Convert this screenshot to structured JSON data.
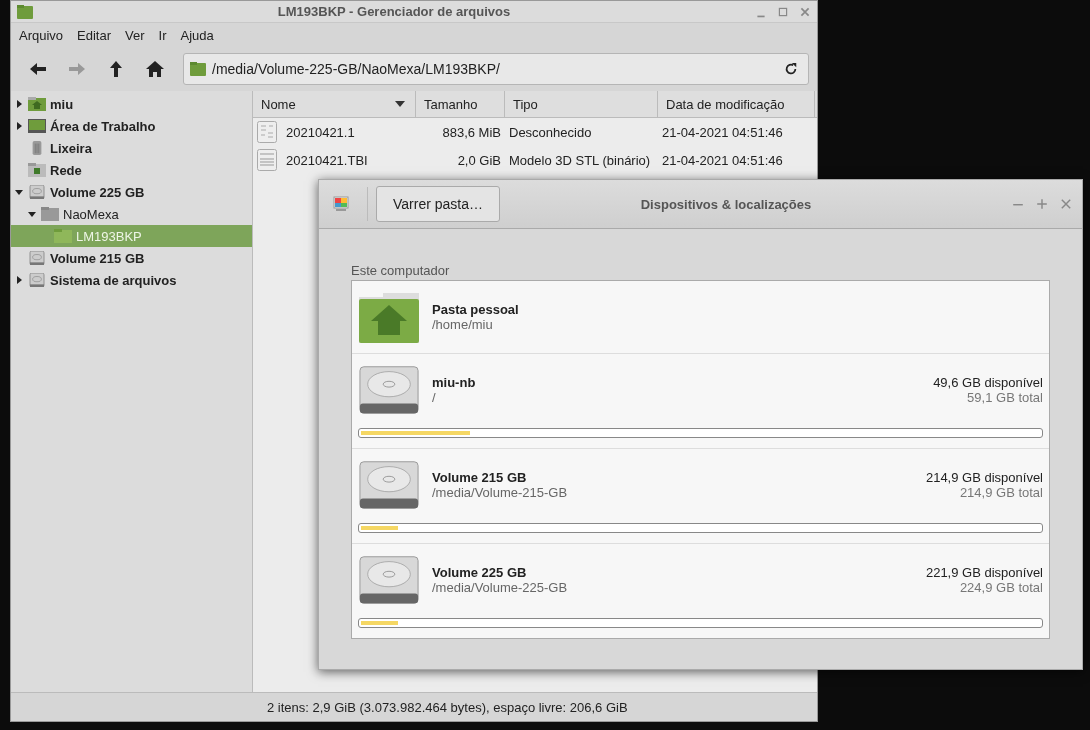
{
  "file_manager": {
    "window": {
      "title": "LM193BKP - Gerenciador de arquivos"
    },
    "menu": [
      "Arquivo",
      "Editar",
      "Ver",
      "Ir",
      "Ajuda"
    ],
    "toolbar": [
      {
        "kind": "back",
        "disabled": false
      },
      {
        "kind": "forward",
        "disabled": true
      },
      {
        "kind": "up",
        "disabled": false
      },
      {
        "kind": "home",
        "disabled": false
      }
    ],
    "location": {
      "value": "/media/Volume-225-GB/NaoMexa/LM193BKP/"
    },
    "sidebar": {
      "items": [
        {
          "label": "miu",
          "kind": "home",
          "expanded": false,
          "selected": false
        },
        {
          "label": "Área de Trabalho",
          "kind": "desktop",
          "expanded": false,
          "selected": false
        },
        {
          "label": "Lixeira",
          "kind": "trash",
          "selected": false
        },
        {
          "label": "Rede",
          "kind": "network",
          "selected": false
        },
        {
          "label": "Volume 225 GB",
          "kind": "drive",
          "expanded": true,
          "selected": false,
          "children": [
            {
              "label": "NaoMexa",
              "kind": "folder",
              "expanded": true,
              "selected": false,
              "children": [
                {
                  "label": "LM193BKP",
                  "kind": "folder",
                  "selected": true
                }
              ]
            }
          ]
        },
        {
          "label": "Volume 215 GB",
          "kind": "drive",
          "selected": false
        },
        {
          "label": "Sistema de arquivos",
          "kind": "drive",
          "expanded": false,
          "selected": false
        }
      ]
    },
    "table": {
      "columns": [
        "Nome",
        "Tamanho",
        "Tipo",
        "Data de modificação"
      ],
      "rows": [
        {
          "kind": "binary",
          "name": "20210421.1",
          "size": "883,6 MiB",
          "type": "Desconhecido",
          "modified": "21-04-2021 04:51:46"
        },
        {
          "kind": "text",
          "name": "20210421.TBI",
          "size": "2,0 GiB",
          "type": "Modelo 3D STL (binário)",
          "modified": "21-04-2021 04:51:46"
        }
      ]
    },
    "status_bar": "2 itens: 2,9 GiB (3.073.982.464 bytes), espaço livre: 206,6 GiB"
  },
  "dialog": {
    "window": {
      "title": "Dispositivos & localizações"
    },
    "button": "Varrer pasta…",
    "section": "Este computador",
    "places": [
      {
        "kind": "home",
        "name": "Pasta pessoal",
        "path": "/home/miu"
      },
      {
        "kind": "drive",
        "name": "miu-nb",
        "path": "/",
        "free": "49,6 GB disponível",
        "total": "59,1 GB total",
        "level": 0.16
      },
      {
        "kind": "drive",
        "name": "Volume 215 GB",
        "path": "/media/Volume-215-GB",
        "free": "214,9 GB disponível",
        "total": "214,9 GB total",
        "level": 0.055
      },
      {
        "kind": "drive",
        "name": "Volume 225 GB",
        "path": "/media/Volume-225-GB",
        "free": "221,9 GB disponível",
        "total": "224,9 GB total",
        "level": 0.055
      }
    ]
  }
}
